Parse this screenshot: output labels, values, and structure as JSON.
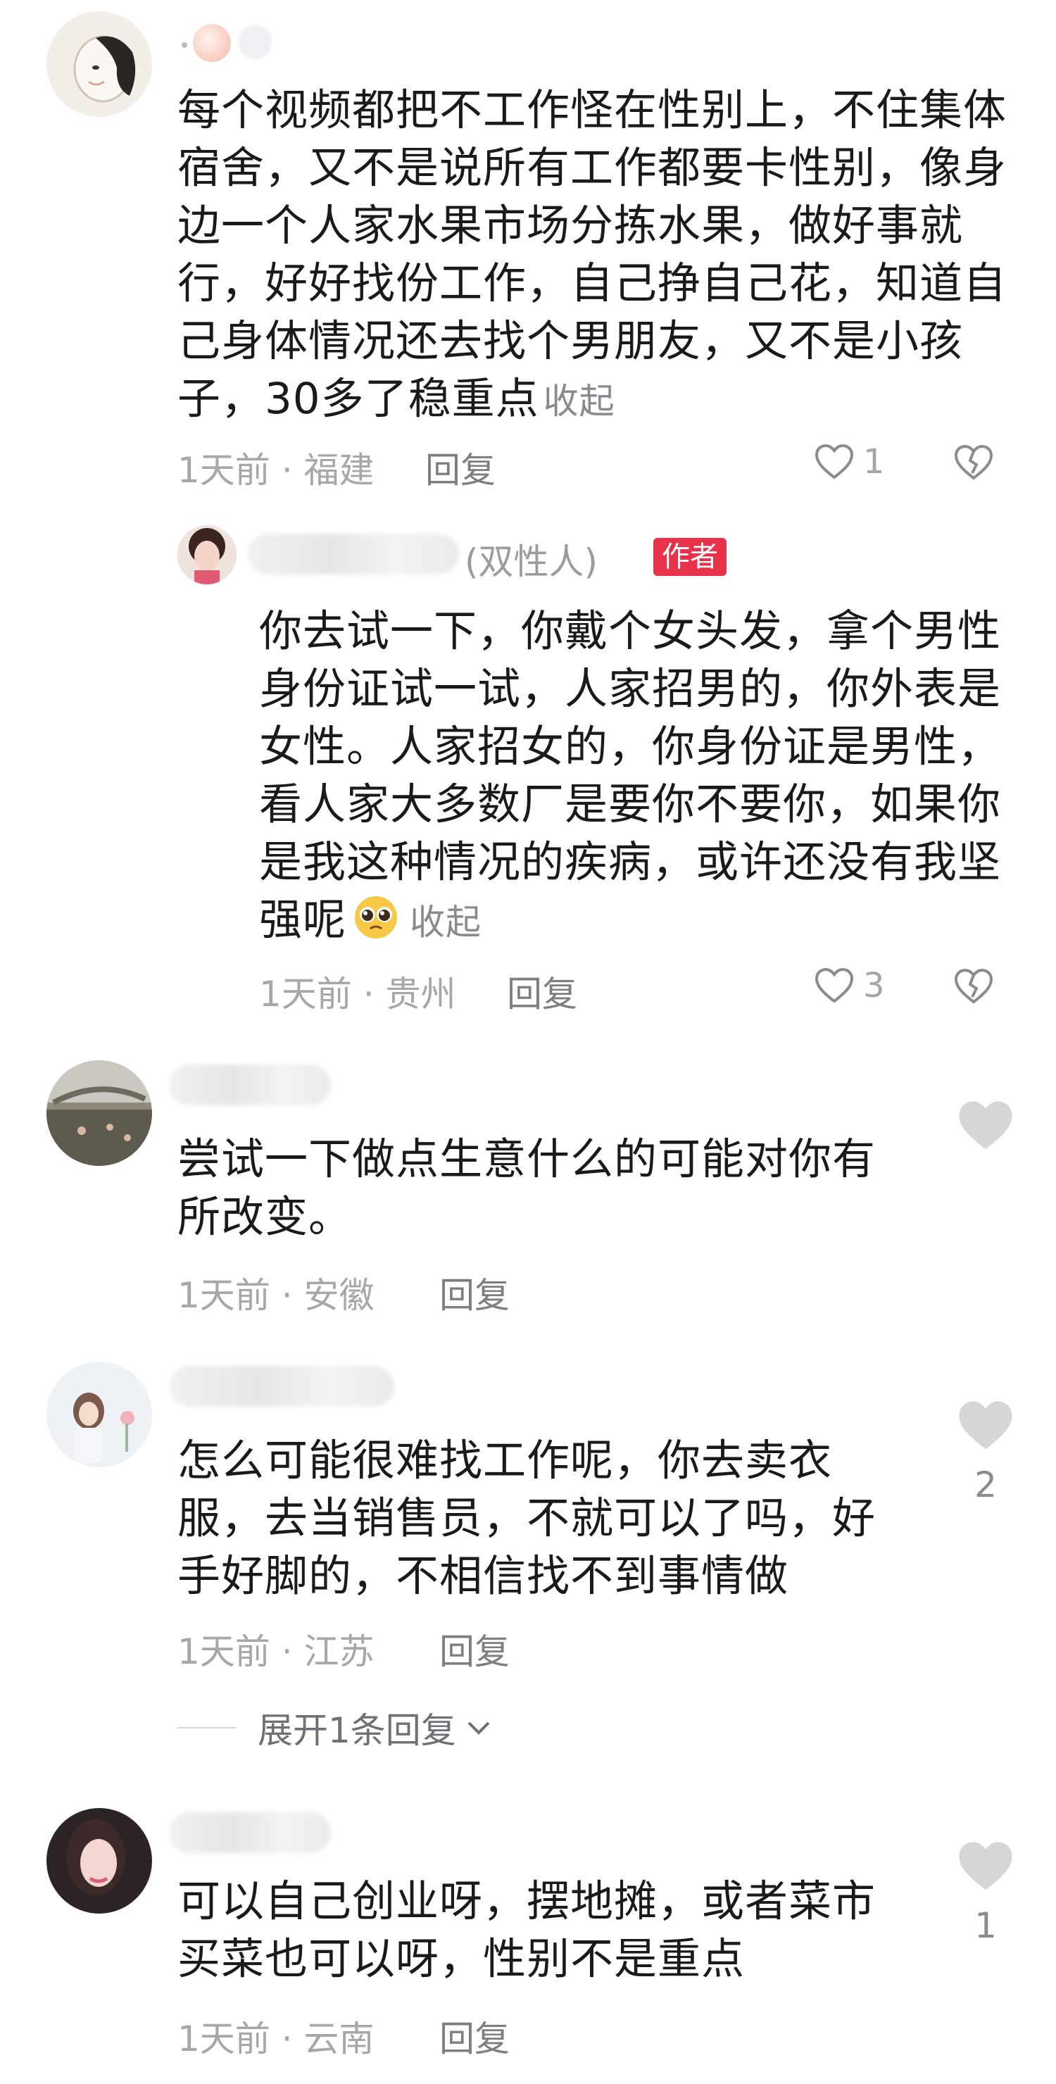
{
  "comments": [
    {
      "text": "每个视频都把不工作怪在性别上，不住集体宿舍，又不是说所有工作都要卡性别，像身边一个人家水果市场分拣水果，做好事就行，好好找份工作，自己挣自己花，知道自己身体情况还去找个男朋友，又不是小孩子，30多了稳重点",
      "lines": [
        "每个视频都把不工作怪在性别上，不住集体",
        "宿舍，又不是说所有工作都要卡性别，像身",
        "边一个人家水果市场分拣水果，做好事就",
        "行，好好找份工作，自己挣自己花，知道自",
        "己身体情况还去找个男朋友，又不是小孩",
        "子，30多了稳重点"
      ],
      "collapse_label": "收起",
      "time": "1天前",
      "location": "福建",
      "reply_label": "回复",
      "likes": "1",
      "reply": {
        "gender_label": "(双性人)",
        "author_badge": "作者",
        "lines": [
          "你去试一下，你戴个女头发，拿个男性",
          "身份证试一试，人家招男的，你外表是",
          "女性。人家招女的，你身份证是男性，",
          "看人家大多数厂是要你不要你，如果你",
          "是我这种情况的疾病，或许还没有我坚",
          "强呢"
        ],
        "collapse_label": "收起",
        "time": "1天前",
        "location": "贵州",
        "reply_label": "回复",
        "likes": "3"
      }
    },
    {
      "lines": [
        "尝试一下做点生意什么的可能对你有",
        "所改变。"
      ],
      "time": "1天前",
      "location": "安徽",
      "reply_label": "回复",
      "likes": ""
    },
    {
      "lines": [
        "怎么可能很难找工作呢，你去卖衣",
        "服，去当销售员，不就可以了吗，好",
        "手好脚的，不相信找不到事情做"
      ],
      "time": "1天前",
      "location": "江苏",
      "reply_label": "回复",
      "likes": "2",
      "expand_label": "展开1条回复"
    },
    {
      "lines": [
        "可以自己创业呀，摆地摊，或者菜市",
        "买菜也可以呀，性别不是重点"
      ],
      "time": "1天前",
      "location": "云南",
      "reply_label": "回复",
      "likes": "1"
    }
  ],
  "colors": {
    "author_badge": "#e8324a",
    "meta_gray": "#a6a7ab",
    "like_gray": "#d6d6d8"
  },
  "icons": [
    "heart-outline-icon",
    "broken-heart-icon",
    "heart-filled-icon",
    "chevron-down-icon"
  ]
}
